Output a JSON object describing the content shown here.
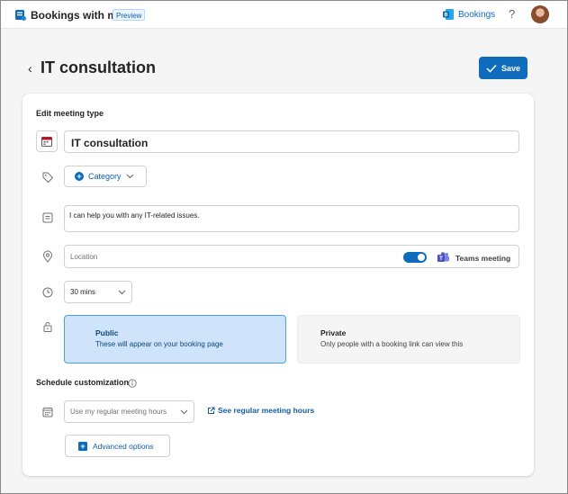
{
  "topbar": {
    "app_title": "Bookings with me",
    "badge": "Preview",
    "bookings_link": "Bookings",
    "help": "?"
  },
  "header": {
    "back": "‹",
    "title": "IT consultation",
    "save_label": "Save"
  },
  "form": {
    "section_heading": "Edit meeting type",
    "title_value": "IT consultation",
    "category_label": "Category",
    "description_value": "I can help you with any IT-related issues.",
    "location_placeholder": "Location",
    "online_meeting_enabled": true,
    "teams_label": "Teams meeting",
    "duration_value": "30 mins",
    "visibility": [
      {
        "title": "Public",
        "subtitle": "These will appear on your booking page",
        "selected": true
      },
      {
        "title": "Private",
        "subtitle": "Only people with a booking link can view this",
        "selected": false
      }
    ],
    "schedule_heading": "Schedule customization",
    "hours_value": "Use my regular meeting hours",
    "see_hours_label": "See regular meeting hours",
    "advanced_label": "Advanced options"
  },
  "colors": {
    "accent": "#0f6cbd",
    "selected_bg": "#cfe4fa",
    "selected_border": "#479ef5"
  }
}
